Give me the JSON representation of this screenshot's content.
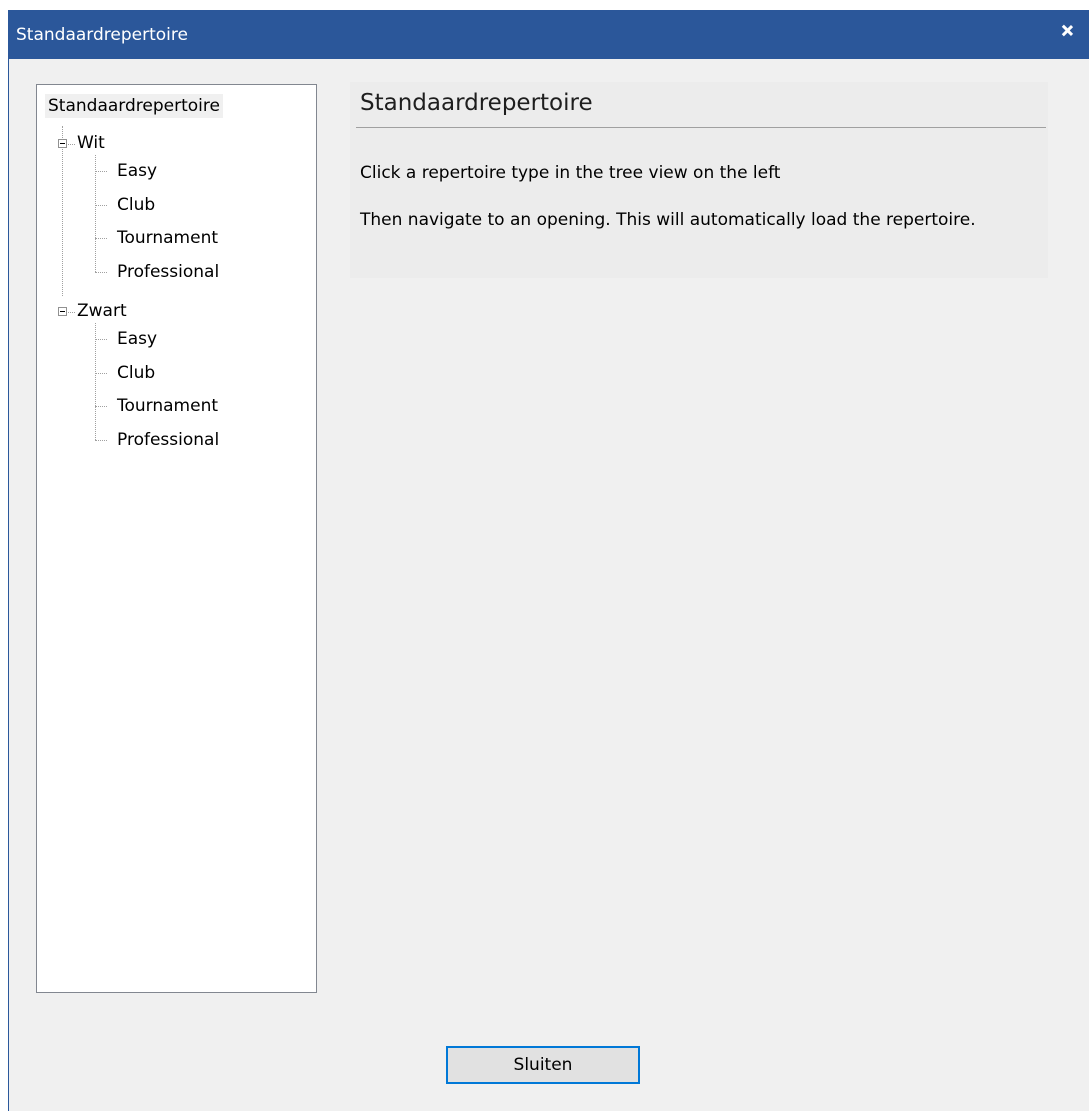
{
  "window": {
    "title": "Standaardrepertoire"
  },
  "tree": {
    "root": "Standaardrepertoire",
    "groups": [
      {
        "label": "Wit",
        "expanded": true,
        "items": [
          "Easy",
          "Club",
          "Tournament",
          "Professional"
        ]
      },
      {
        "label": "Zwart",
        "expanded": true,
        "items": [
          "Easy",
          "Club",
          "Tournament",
          "Professional"
        ]
      }
    ]
  },
  "content": {
    "heading": "Standaardrepertoire",
    "line1": "Click a repertoire type in the tree view on the left",
    "line2": "Then navigate to an opening. This will automatically load the repertoire."
  },
  "buttons": {
    "close_label": "Sluiten"
  },
  "colors": {
    "titlebar": "#2b579a",
    "button_border": "#0078d7",
    "dialog_bg": "#f0f0f0"
  }
}
